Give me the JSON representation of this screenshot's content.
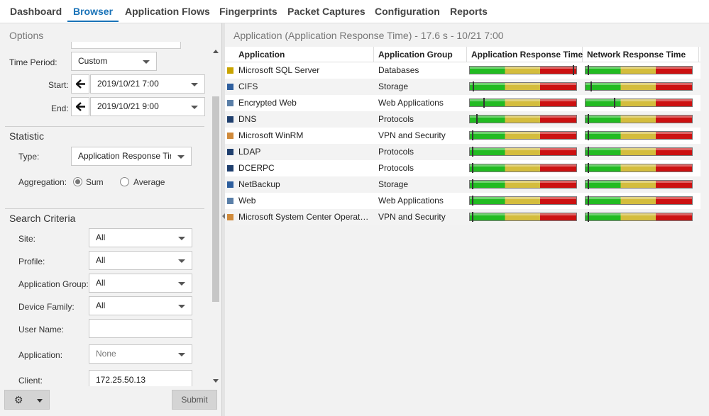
{
  "nav": {
    "tabs": [
      {
        "label": "Dashboard"
      },
      {
        "label": "Browser"
      },
      {
        "label": "Application Flows"
      },
      {
        "label": "Fingerprints"
      },
      {
        "label": "Packet Captures"
      },
      {
        "label": "Configuration"
      },
      {
        "label": "Reports"
      }
    ],
    "active": "Browser"
  },
  "options": {
    "title": "Options",
    "time_period": {
      "label": "Time Period:",
      "value": "Custom"
    },
    "start": {
      "label": "Start:",
      "value": "2019/10/21 7:00"
    },
    "end": {
      "label": "End:",
      "value": "2019/10/21 9:00"
    }
  },
  "statistic": {
    "title": "Statistic",
    "type": {
      "label": "Type:",
      "value": "Application Response Tir"
    },
    "aggregation": {
      "label": "Aggregation:",
      "options": [
        "Sum",
        "Average"
      ],
      "selected": "Sum"
    }
  },
  "search_criteria": {
    "title": "Search Criteria",
    "site": {
      "label": "Site:",
      "value": "All"
    },
    "profile": {
      "label": "Profile:",
      "value": "All"
    },
    "application_group": {
      "label": "Application Group:",
      "value": "All"
    },
    "device_family": {
      "label": "Device Family:",
      "value": "All"
    },
    "user_name": {
      "label": "User Name:",
      "value": ""
    },
    "application": {
      "label": "Application:",
      "value": "None"
    },
    "client": {
      "label": "Client:",
      "value": "172.25.50.13"
    }
  },
  "footer": {
    "gear_icon": "gear-icon",
    "submit_label": "Submit"
  },
  "results": {
    "title": "Application (Application Response Time) - 17.6 s - 10/21 7:00",
    "columns": [
      "Application",
      "Application Group",
      "Application Response Time",
      "Network Response Time"
    ],
    "rows": [
      {
        "application": "Microsoft SQL Server",
        "group": "Databases",
        "icon": "database-app-icon",
        "icon_color": "#c9a400",
        "art": 0.98,
        "nrt": 0.02
      },
      {
        "application": "CIFS",
        "group": "Storage",
        "icon": "storage-app-icon",
        "icon_color": "#2e5f9e",
        "art": 0.03,
        "nrt": 0.05
      },
      {
        "application": "Encrypted Web",
        "group": "Web Applications",
        "icon": "web-app-icon",
        "icon_color": "#5a7fa8",
        "art": 0.13,
        "nrt": 0.27
      },
      {
        "application": "DNS",
        "group": "Protocols",
        "icon": "protocol-app-icon",
        "icon_color": "#1f3f6e",
        "art": 0.06,
        "nrt": 0.02
      },
      {
        "application": "Microsoft WinRM",
        "group": "VPN and Security",
        "icon": "security-app-icon",
        "icon_color": "#d08a3a",
        "art": 0.02,
        "nrt": 0.02
      },
      {
        "application": "LDAP",
        "group": "Protocols",
        "icon": "protocol-app-icon",
        "icon_color": "#1f3f6e",
        "art": 0.02,
        "nrt": 0.02
      },
      {
        "application": "DCERPC",
        "group": "Protocols",
        "icon": "protocol-app-icon",
        "icon_color": "#1f3f6e",
        "art": 0.02,
        "nrt": 0.02
      },
      {
        "application": "NetBackup",
        "group": "Storage",
        "icon": "storage-app-icon",
        "icon_color": "#2e5f9e",
        "art": 0.02,
        "nrt": 0.02
      },
      {
        "application": "Web",
        "group": "Web Applications",
        "icon": "web-app-icon",
        "icon_color": "#5a7fa8",
        "art": 0.02,
        "nrt": 0.02
      },
      {
        "application": "Microsoft System Center Operatio…",
        "group": "VPN and Security",
        "icon": "security-app-icon",
        "icon_color": "#d08a3a",
        "art": 0.02,
        "nrt": 0.02
      }
    ]
  }
}
